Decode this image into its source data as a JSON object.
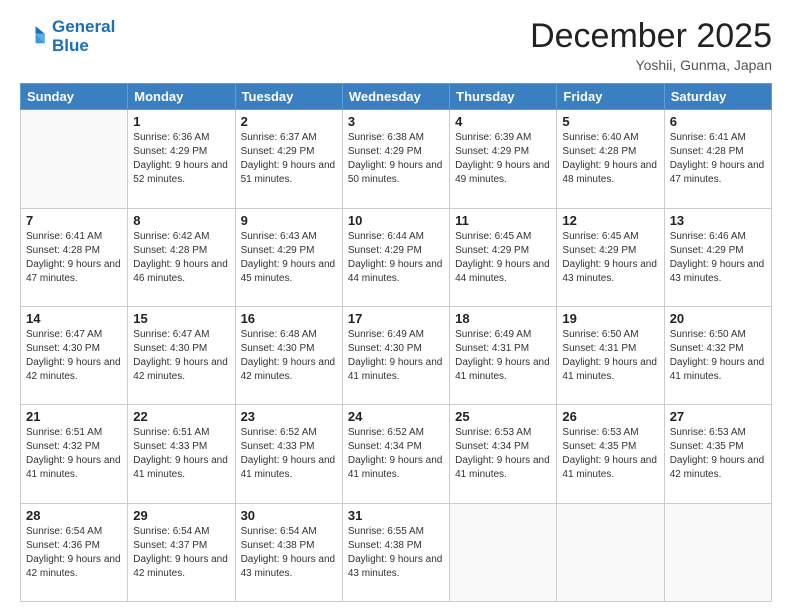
{
  "header": {
    "logo_line1": "General",
    "logo_line2": "Blue",
    "month_title": "December 2025",
    "location": "Yoshii, Gunma, Japan"
  },
  "days_of_week": [
    "Sunday",
    "Monday",
    "Tuesday",
    "Wednesday",
    "Thursday",
    "Friday",
    "Saturday"
  ],
  "weeks": [
    [
      {
        "day": "",
        "sunrise": "",
        "sunset": "",
        "daylight": ""
      },
      {
        "day": "1",
        "sunrise": "Sunrise: 6:36 AM",
        "sunset": "Sunset: 4:29 PM",
        "daylight": "Daylight: 9 hours and 52 minutes."
      },
      {
        "day": "2",
        "sunrise": "Sunrise: 6:37 AM",
        "sunset": "Sunset: 4:29 PM",
        "daylight": "Daylight: 9 hours and 51 minutes."
      },
      {
        "day": "3",
        "sunrise": "Sunrise: 6:38 AM",
        "sunset": "Sunset: 4:29 PM",
        "daylight": "Daylight: 9 hours and 50 minutes."
      },
      {
        "day": "4",
        "sunrise": "Sunrise: 6:39 AM",
        "sunset": "Sunset: 4:29 PM",
        "daylight": "Daylight: 9 hours and 49 minutes."
      },
      {
        "day": "5",
        "sunrise": "Sunrise: 6:40 AM",
        "sunset": "Sunset: 4:28 PM",
        "daylight": "Daylight: 9 hours and 48 minutes."
      },
      {
        "day": "6",
        "sunrise": "Sunrise: 6:41 AM",
        "sunset": "Sunset: 4:28 PM",
        "daylight": "Daylight: 9 hours and 47 minutes."
      }
    ],
    [
      {
        "day": "7",
        "sunrise": "Sunrise: 6:41 AM",
        "sunset": "Sunset: 4:28 PM",
        "daylight": "Daylight: 9 hours and 47 minutes."
      },
      {
        "day": "8",
        "sunrise": "Sunrise: 6:42 AM",
        "sunset": "Sunset: 4:28 PM",
        "daylight": "Daylight: 9 hours and 46 minutes."
      },
      {
        "day": "9",
        "sunrise": "Sunrise: 6:43 AM",
        "sunset": "Sunset: 4:29 PM",
        "daylight": "Daylight: 9 hours and 45 minutes."
      },
      {
        "day": "10",
        "sunrise": "Sunrise: 6:44 AM",
        "sunset": "Sunset: 4:29 PM",
        "daylight": "Daylight: 9 hours and 44 minutes."
      },
      {
        "day": "11",
        "sunrise": "Sunrise: 6:45 AM",
        "sunset": "Sunset: 4:29 PM",
        "daylight": "Daylight: 9 hours and 44 minutes."
      },
      {
        "day": "12",
        "sunrise": "Sunrise: 6:45 AM",
        "sunset": "Sunset: 4:29 PM",
        "daylight": "Daylight: 9 hours and 43 minutes."
      },
      {
        "day": "13",
        "sunrise": "Sunrise: 6:46 AM",
        "sunset": "Sunset: 4:29 PM",
        "daylight": "Daylight: 9 hours and 43 minutes."
      }
    ],
    [
      {
        "day": "14",
        "sunrise": "Sunrise: 6:47 AM",
        "sunset": "Sunset: 4:30 PM",
        "daylight": "Daylight: 9 hours and 42 minutes."
      },
      {
        "day": "15",
        "sunrise": "Sunrise: 6:47 AM",
        "sunset": "Sunset: 4:30 PM",
        "daylight": "Daylight: 9 hours and 42 minutes."
      },
      {
        "day": "16",
        "sunrise": "Sunrise: 6:48 AM",
        "sunset": "Sunset: 4:30 PM",
        "daylight": "Daylight: 9 hours and 42 minutes."
      },
      {
        "day": "17",
        "sunrise": "Sunrise: 6:49 AM",
        "sunset": "Sunset: 4:30 PM",
        "daylight": "Daylight: 9 hours and 41 minutes."
      },
      {
        "day": "18",
        "sunrise": "Sunrise: 6:49 AM",
        "sunset": "Sunset: 4:31 PM",
        "daylight": "Daylight: 9 hours and 41 minutes."
      },
      {
        "day": "19",
        "sunrise": "Sunrise: 6:50 AM",
        "sunset": "Sunset: 4:31 PM",
        "daylight": "Daylight: 9 hours and 41 minutes."
      },
      {
        "day": "20",
        "sunrise": "Sunrise: 6:50 AM",
        "sunset": "Sunset: 4:32 PM",
        "daylight": "Daylight: 9 hours and 41 minutes."
      }
    ],
    [
      {
        "day": "21",
        "sunrise": "Sunrise: 6:51 AM",
        "sunset": "Sunset: 4:32 PM",
        "daylight": "Daylight: 9 hours and 41 minutes."
      },
      {
        "day": "22",
        "sunrise": "Sunrise: 6:51 AM",
        "sunset": "Sunset: 4:33 PM",
        "daylight": "Daylight: 9 hours and 41 minutes."
      },
      {
        "day": "23",
        "sunrise": "Sunrise: 6:52 AM",
        "sunset": "Sunset: 4:33 PM",
        "daylight": "Daylight: 9 hours and 41 minutes."
      },
      {
        "day": "24",
        "sunrise": "Sunrise: 6:52 AM",
        "sunset": "Sunset: 4:34 PM",
        "daylight": "Daylight: 9 hours and 41 minutes."
      },
      {
        "day": "25",
        "sunrise": "Sunrise: 6:53 AM",
        "sunset": "Sunset: 4:34 PM",
        "daylight": "Daylight: 9 hours and 41 minutes."
      },
      {
        "day": "26",
        "sunrise": "Sunrise: 6:53 AM",
        "sunset": "Sunset: 4:35 PM",
        "daylight": "Daylight: 9 hours and 41 minutes."
      },
      {
        "day": "27",
        "sunrise": "Sunrise: 6:53 AM",
        "sunset": "Sunset: 4:35 PM",
        "daylight": "Daylight: 9 hours and 42 minutes."
      }
    ],
    [
      {
        "day": "28",
        "sunrise": "Sunrise: 6:54 AM",
        "sunset": "Sunset: 4:36 PM",
        "daylight": "Daylight: 9 hours and 42 minutes."
      },
      {
        "day": "29",
        "sunrise": "Sunrise: 6:54 AM",
        "sunset": "Sunset: 4:37 PM",
        "daylight": "Daylight: 9 hours and 42 minutes."
      },
      {
        "day": "30",
        "sunrise": "Sunrise: 6:54 AM",
        "sunset": "Sunset: 4:38 PM",
        "daylight": "Daylight: 9 hours and 43 minutes."
      },
      {
        "day": "31",
        "sunrise": "Sunrise: 6:55 AM",
        "sunset": "Sunset: 4:38 PM",
        "daylight": "Daylight: 9 hours and 43 minutes."
      },
      {
        "day": "",
        "sunrise": "",
        "sunset": "",
        "daylight": ""
      },
      {
        "day": "",
        "sunrise": "",
        "sunset": "",
        "daylight": ""
      },
      {
        "day": "",
        "sunrise": "",
        "sunset": "",
        "daylight": ""
      }
    ]
  ]
}
